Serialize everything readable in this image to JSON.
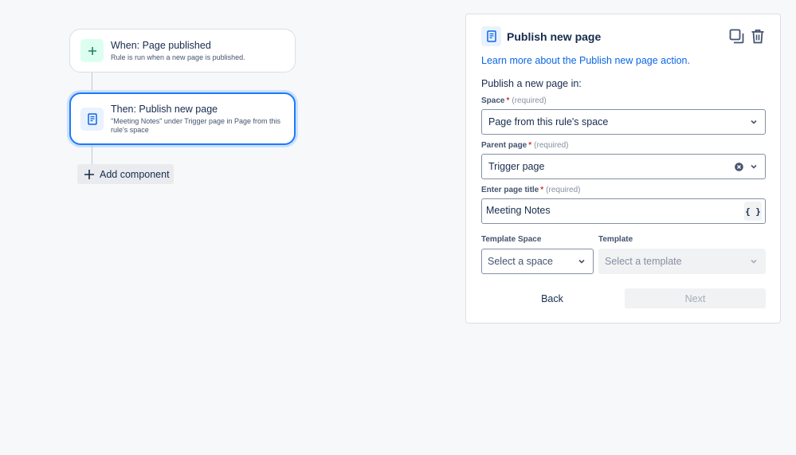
{
  "flow": {
    "trigger": {
      "title": "When: Page published",
      "subtitle": "Rule is run when a new page is published.",
      "icon": "plus-icon"
    },
    "action": {
      "title": "Then: Publish new page",
      "subtitle": "\"Meeting Notes\" under Trigger page in Page from this rule's space",
      "icon": "page-icon"
    },
    "add_component_label": "Add component"
  },
  "panel": {
    "title": "Publish new page",
    "icon": "page-icon",
    "learn_more_link": "Learn more about the Publish new page action.",
    "section_label": "Publish a new page in:",
    "required_note": "(required)",
    "fields": {
      "space": {
        "label": "Space",
        "value": "Page from this rule's space"
      },
      "parent_page": {
        "label": "Parent page",
        "value": "Trigger page"
      },
      "page_title": {
        "label": "Enter page title",
        "value": "Meeting Notes",
        "smart_value_button": "{ }"
      },
      "template_space": {
        "label": "Template Space",
        "placeholder": "Select a space"
      },
      "template": {
        "label": "Template",
        "placeholder": "Select a template",
        "disabled": true
      }
    },
    "buttons": {
      "back": "Back",
      "next": "Next"
    }
  },
  "colors": {
    "accent": "#1d7afc",
    "link": "#0c66e4",
    "trigger_icon_bg": "#dcfff1",
    "required": "#c9372c"
  }
}
